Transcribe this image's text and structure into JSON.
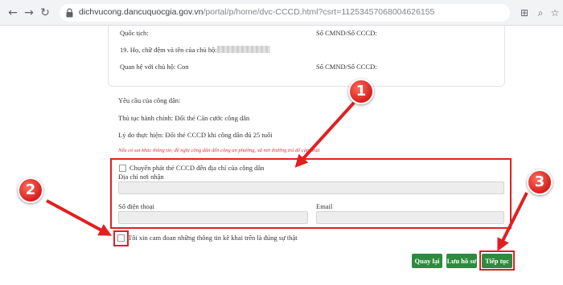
{
  "browser": {
    "url_host": "dichvucong.dancuquocgia.gov.vn",
    "url_path": "/portal/p/home/dvc-CCCD.html?csrt=11253457068004626155"
  },
  "info": {
    "nationality_label": "Quốc tịch:",
    "cmnd_label": "Số CMND/Số CCCD:",
    "head_name_label": "19. Họ, chữ đệm và tên của chủ hộ:",
    "relation_label": "Quan hệ với chủ hộ: Con",
    "cmnd_label_2": "Số CMND/Số CCCD:"
  },
  "request": {
    "heading": "Yêu cầu của công dân:",
    "procedure": "Thủ tục hành chính: Đổi thẻ Căn cước công dân",
    "reason": "Lý do thực hiện: Đổi thẻ CCCD khi công dân đủ 25 tuổi",
    "note": "Nếu có sai khác thông tin, đề nghị công dân đến công an phường, xã nơi thường trú để cập nhật"
  },
  "delivery": {
    "checkbox_label": "Chuyển phát thẻ CCCD đến địa chỉ của công dân",
    "address_label": "Địa chỉ nơi nhận",
    "phone_label": "Số điện thoại",
    "email_label": "Email"
  },
  "commitment": "Tôi xin cam đoan những thông tin kê khai trên là đúng sự thật",
  "buttons": {
    "back": "Quay lại",
    "save": "Lưu hồ sơ",
    "next": "Tiếp tục"
  },
  "badges": [
    "1",
    "2",
    "3"
  ],
  "colors": {
    "highlight": "#e02020",
    "button": "#2e8b3e",
    "badge": "#d61f1f"
  }
}
